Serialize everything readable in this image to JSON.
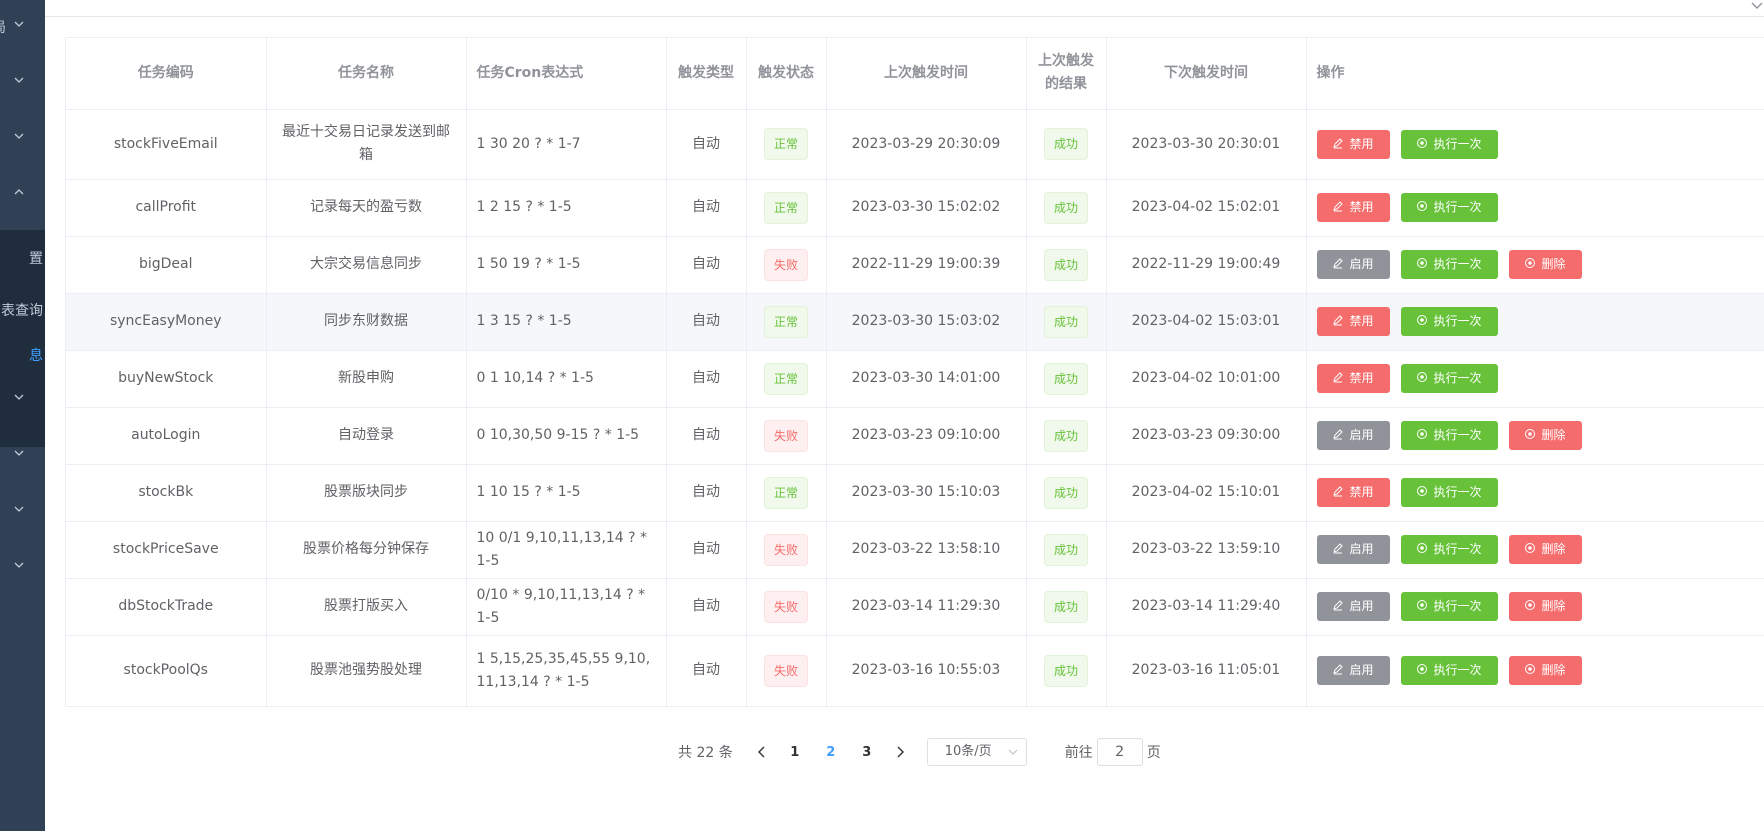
{
  "sidebar": {
    "items": [
      {
        "label": "局",
        "type": "chevron"
      },
      {
        "label": "",
        "type": "chevron"
      },
      {
        "label": "",
        "type": "chevron"
      },
      {
        "label": "",
        "type": "chevron-up"
      },
      {
        "label": "置",
        "type": "sub"
      },
      {
        "label": "表查询",
        "type": "sub"
      },
      {
        "label": "息",
        "type": "sub-active"
      },
      {
        "label": "",
        "type": "chevron"
      },
      {
        "label": "",
        "type": "chevron"
      },
      {
        "label": "",
        "type": "chevron"
      },
      {
        "label": "",
        "type": "chevron"
      }
    ]
  },
  "table": {
    "headers": {
      "code": "任务编码",
      "name": "任务名称",
      "cron": "任务Cron表达式",
      "trigger_type": "触发类型",
      "trigger_status": "触发状态",
      "last_time": "上次触发时间",
      "last_result": "上次触发的结果",
      "next_time": "下次触发时间",
      "actions": "操作"
    },
    "rows": [
      {
        "code": "stockFiveEmail",
        "name": "最近十交易日记录发送到邮箱",
        "cron": "1 30 20 ? * 1-7",
        "type": "自动",
        "status": "正常",
        "last": "2023-03-29 20:30:09",
        "result": "成功",
        "next": "2023-03-30 20:30:01",
        "toggle": "禁用",
        "run": "执行一次",
        "del": ""
      },
      {
        "code": "callProfit",
        "name": "记录每天的盈亏数",
        "cron": "1 2 15 ? * 1-5",
        "type": "自动",
        "status": "正常",
        "last": "2023-03-30 15:02:02",
        "result": "成功",
        "next": "2023-04-02 15:02:01",
        "toggle": "禁用",
        "run": "执行一次",
        "del": ""
      },
      {
        "code": "bigDeal",
        "name": "大宗交易信息同步",
        "cron": "1 50 19 ? * 1-5",
        "type": "自动",
        "status": "失败",
        "last": "2022-11-29 19:00:39",
        "result": "成功",
        "next": "2022-11-29 19:00:49",
        "toggle": "启用",
        "run": "执行一次",
        "del": "删除"
      },
      {
        "code": "syncEasyMoney",
        "name": "同步东财数据",
        "cron": "1 3 15 ? * 1-5",
        "type": "自动",
        "status": "正常",
        "last": "2023-03-30 15:03:02",
        "result": "成功",
        "next": "2023-04-02 15:03:01",
        "toggle": "禁用",
        "run": "执行一次",
        "del": ""
      },
      {
        "code": "buyNewStock",
        "name": "新股申购",
        "cron": "0 1 10,14 ? * 1-5",
        "type": "自动",
        "status": "正常",
        "last": "2023-03-30 14:01:00",
        "result": "成功",
        "next": "2023-04-02 10:01:00",
        "toggle": "禁用",
        "run": "执行一次",
        "del": ""
      },
      {
        "code": "autoLogin",
        "name": "自动登录",
        "cron": "0 10,30,50 9-15 ? * 1-5",
        "type": "自动",
        "status": "失败",
        "last": "2023-03-23 09:10:00",
        "result": "成功",
        "next": "2023-03-23 09:30:00",
        "toggle": "启用",
        "run": "执行一次",
        "del": "删除"
      },
      {
        "code": "stockBk",
        "name": "股票版块同步",
        "cron": "1 10 15 ? * 1-5",
        "type": "自动",
        "status": "正常",
        "last": "2023-03-30 15:10:03",
        "result": "成功",
        "next": "2023-04-02 15:10:01",
        "toggle": "禁用",
        "run": "执行一次",
        "del": ""
      },
      {
        "code": "stockPriceSave",
        "name": "股票价格每分钟保存",
        "cron": "10 0/1 9,10,11,13,14 ? * 1-5",
        "type": "自动",
        "status": "失败",
        "last": "2023-03-22 13:58:10",
        "result": "成功",
        "next": "2023-03-22 13:59:10",
        "toggle": "启用",
        "run": "执行一次",
        "del": "删除"
      },
      {
        "code": "dbStockTrade",
        "name": "股票打版买入",
        "cron": "0/10 * 9,10,11,13,14 ? * 1-5",
        "type": "自动",
        "status": "失败",
        "last": "2023-03-14 11:29:30",
        "result": "成功",
        "next": "2023-03-14 11:29:40",
        "toggle": "启用",
        "run": "执行一次",
        "del": "删除"
      },
      {
        "code": "stockPoolQs",
        "name": "股票池强势股处理",
        "cron": "1 5,15,25,35,45,55 9,10,11,13,14 ? * 1-5",
        "type": "自动",
        "status": "失败",
        "last": "2023-03-16 10:55:03",
        "result": "成功",
        "next": "2023-03-16 11:05:01",
        "toggle": "启用",
        "run": "执行一次",
        "del": "删除"
      }
    ]
  },
  "pagination": {
    "total": "共 22 条",
    "pages": [
      "1",
      "2",
      "3"
    ],
    "current": "2",
    "page_size": "10条/页",
    "goto_label": "前往",
    "goto_value": "2",
    "goto_suffix": "页"
  },
  "colors": {
    "sidebar_bg": "#304156",
    "sidebar_active_text": "#409eff",
    "success": "#67c23a",
    "danger": "#f56c6c",
    "info": "#909399"
  }
}
